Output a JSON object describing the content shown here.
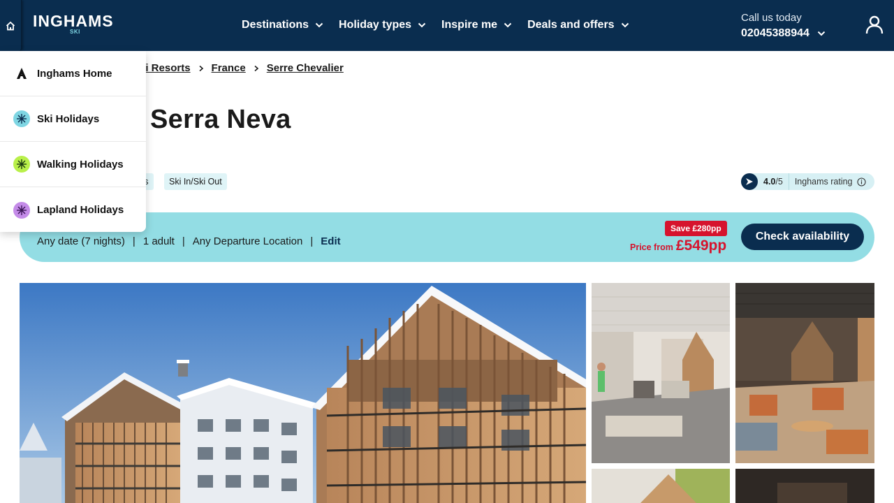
{
  "header": {
    "logo": {
      "main": "INGHAMS",
      "sub": "SKI"
    },
    "nav": [
      {
        "label": "Destinations"
      },
      {
        "label": "Holiday types"
      },
      {
        "label": "Inspire me"
      },
      {
        "label": "Deals and offers"
      }
    ],
    "call": {
      "label": "Call us today",
      "number": "02045388944"
    },
    "icons": {
      "home": "home-icon",
      "user": "user-icon",
      "chevron": "chevron-down-icon"
    }
  },
  "dropdown": {
    "items": [
      {
        "label": "Inghams Home",
        "icon": "inghams-logo-icon",
        "color": "#111111"
      },
      {
        "label": "Ski Holidays",
        "icon": "snowflake-icon",
        "color": "#7fd6e3"
      },
      {
        "label": "Walking Holidays",
        "icon": "snowflake-icon",
        "color": "#b9f04a"
      },
      {
        "label": "Lapland Holidays",
        "icon": "snowflake-icon",
        "color": "#c48be8"
      }
    ]
  },
  "breadcrumb": {
    "items": [
      "ki Resorts",
      "France",
      "Serre Chevalier"
    ]
  },
  "page": {
    "title": "Serra Neva",
    "tags": [
      "ss",
      "Ski In/Ski Out"
    ]
  },
  "rating": {
    "score": "4.0",
    "max": "/5",
    "label": "Inghams rating"
  },
  "availability": {
    "date": "Any date (7 nights)",
    "guests": "1 adult",
    "departure": "Any Departure Location",
    "pipe": "|",
    "edit": "Edit",
    "save_badge": "Save £280pp",
    "price_label": "Price from",
    "price_value": "£549pp",
    "check_button": "Check availability"
  },
  "colors": {
    "navy": "#0a2d4f",
    "aqua": "#93dde4",
    "sale_red": "#d6132d"
  }
}
